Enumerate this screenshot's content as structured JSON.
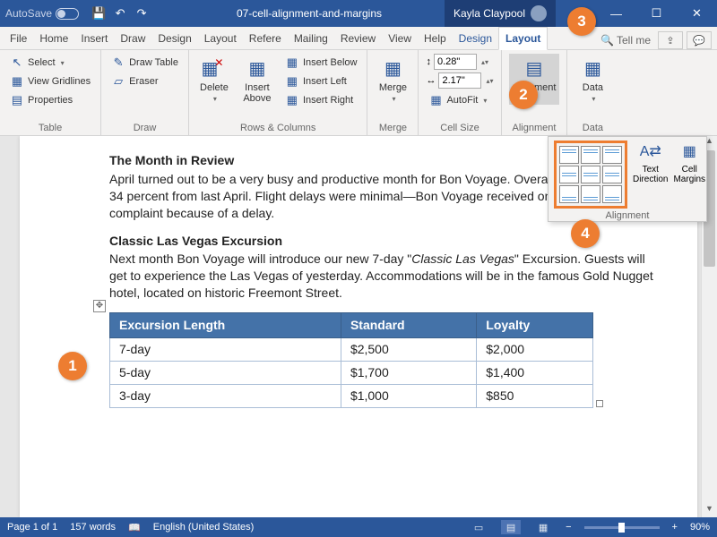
{
  "titlebar": {
    "autosave": "AutoSave",
    "title": "07-cell-alignment-and-margins",
    "user": "Kayla Claypool"
  },
  "tabs": {
    "file": "File",
    "home": "Home",
    "insert": "Insert",
    "draw": "Draw",
    "design": "Design",
    "layout": "Layout",
    "refere": "Refere",
    "mailing": "Mailing",
    "review": "Review",
    "view": "View",
    "help": "Help",
    "tt_design": "Design",
    "tt_layout": "Layout",
    "tellme": "Tell me"
  },
  "ribbon": {
    "table": {
      "select": "Select",
      "gridlines": "View Gridlines",
      "properties": "Properties",
      "group": "Table"
    },
    "draw": {
      "drawtable": "Draw Table",
      "eraser": "Eraser",
      "group": "Draw"
    },
    "rowscols": {
      "delete": "Delete",
      "insertabove": "Insert\nAbove",
      "insertbelow": "Insert Below",
      "insertleft": "Insert Left",
      "insertright": "Insert Right",
      "group": "Rows & Columns"
    },
    "merge": {
      "merge": "Merge",
      "group": "Merge"
    },
    "cellsize": {
      "height": "0.28\"",
      "width": "2.17\"",
      "autofit": "AutoFit",
      "group": "Cell Size"
    },
    "alignment": {
      "alignment": "Alignment",
      "group": "Alignment"
    },
    "data": {
      "data": "Data",
      "group": "Data"
    }
  },
  "alignpanel": {
    "textdir": "Text\nDirection",
    "cellmargins": "Cell\nMargins",
    "group": "Alignment"
  },
  "doc": {
    "h1": "The Month in Review",
    "p1": "April turned out to be a very busy and productive month for Bon Voyage. Overall business was up 34 percent from last April. Flight delays were minimal—Bon Voyage received only one customer complaint because of a delay.",
    "h2": "Classic Las Vegas Excursion",
    "p2a": "Next month Bon Voyage will introduce our new 7-day \"",
    "p2b": "Classic Las Vegas",
    "p2c": "\" Excursion. Guests will get to experience the Las Vegas of yesterday. Accommodations will be in the famous Gold Nugget hotel, located on historic Freemont Street.",
    "table": {
      "headers": [
        "Excursion Length",
        "Standard",
        "Loyalty"
      ],
      "rows": [
        [
          "7-day",
          "$2,500",
          "$2,000"
        ],
        [
          "5-day",
          "$1,700",
          "$1,400"
        ],
        [
          "3-day",
          "$1,000",
          "$850"
        ]
      ]
    }
  },
  "status": {
    "page": "Page 1 of 1",
    "words": "157 words",
    "lang": "English (United States)",
    "zoom": "90%"
  },
  "bubbles": {
    "b1": "1",
    "b2": "2",
    "b3": "3",
    "b4": "4"
  },
  "colors": {
    "accent": "#2b579a",
    "callout": "#ed7d31",
    "table_header": "#4472a8"
  }
}
